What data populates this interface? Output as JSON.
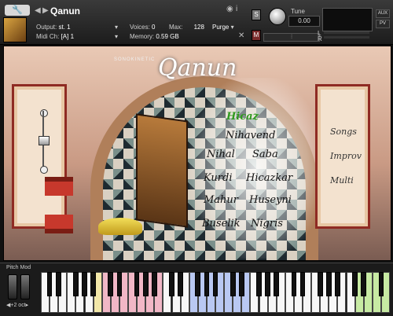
{
  "header": {
    "instrument_title": "Qanun",
    "output_label": "Output:",
    "output_value": "st. 1",
    "voices_label": "Voices:",
    "voices_value": "0",
    "max_label": "Max:",
    "max_value": "128",
    "purge_label": "Purge",
    "midi_label": "Midi Ch:",
    "midi_value": "[A]  1",
    "memory_label": "Memory:",
    "memory_value": "0.59 GB",
    "s_button": "S",
    "m_button": "M",
    "tune_label": "Tune",
    "tune_value": "0.00",
    "aux_label": "AUX",
    "pv_label": "PV",
    "l_label": "L",
    "r_label": "R",
    "icons": [
      "wrench-icon",
      "camera-icon",
      "info-icon",
      "close-icon"
    ]
  },
  "main": {
    "brand_small": "SONOKINETIC",
    "logo": "Qanun",
    "scales": [
      {
        "label": "Hicaz",
        "active": true
      },
      {
        "label": "Nihavend",
        "active": false
      },
      {
        "label": "Nihal",
        "active": false
      },
      {
        "label": "Saba",
        "active": false
      },
      {
        "label": "Kurdi",
        "active": false
      },
      {
        "label": "Hicazkar",
        "active": false
      },
      {
        "label": "Mahur",
        "active": false
      },
      {
        "label": "Huseyni",
        "active": false
      },
      {
        "label": "Buselik",
        "active": false
      },
      {
        "label": "Nigris",
        "active": false
      }
    ],
    "right_menu": [
      "Songs",
      "Improv",
      "Multi"
    ]
  },
  "keyboard": {
    "pitch_mod_label": "Pitch Mod",
    "octave_label": "◀+2 oct▸",
    "colors": {
      "pink": "#f1b7c6",
      "blue": "#b9c8f2",
      "green": "#c7eaa3",
      "yellow": "#f2e7a8"
    }
  }
}
